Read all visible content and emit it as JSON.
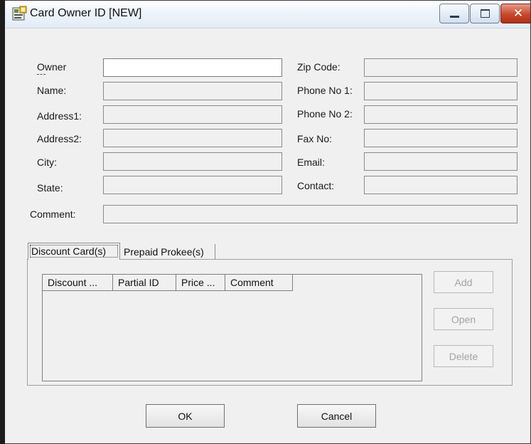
{
  "window": {
    "title": "Card Owner ID  [NEW]"
  },
  "form": {
    "left_labels": [
      "Owner",
      "Name:",
      "Address1:",
      "Address2:",
      "City:",
      "State:"
    ],
    "right_labels": [
      "Zip Code:",
      "Phone No 1:",
      "Phone No 2:",
      "Fax No:",
      "Email:",
      "Contact:"
    ],
    "comment_label": "Comment:",
    "values": {
      "owner_id": ""
    }
  },
  "tabs": [
    {
      "label": "Discount Card(s)",
      "selected": true
    },
    {
      "label": "Prepaid Prokee(s)",
      "selected": false
    }
  ],
  "list": {
    "columns": [
      "Discount ...",
      "Partial ID",
      "Price ...",
      "Comment"
    ],
    "rows": []
  },
  "side_buttons": {
    "add": "Add",
    "open": "Open",
    "delete": "Delete"
  },
  "footer": {
    "ok": "OK",
    "cancel": "Cancel"
  },
  "colors": {
    "close_button": "#c6482c",
    "window_bg": "#f0f0f0"
  }
}
